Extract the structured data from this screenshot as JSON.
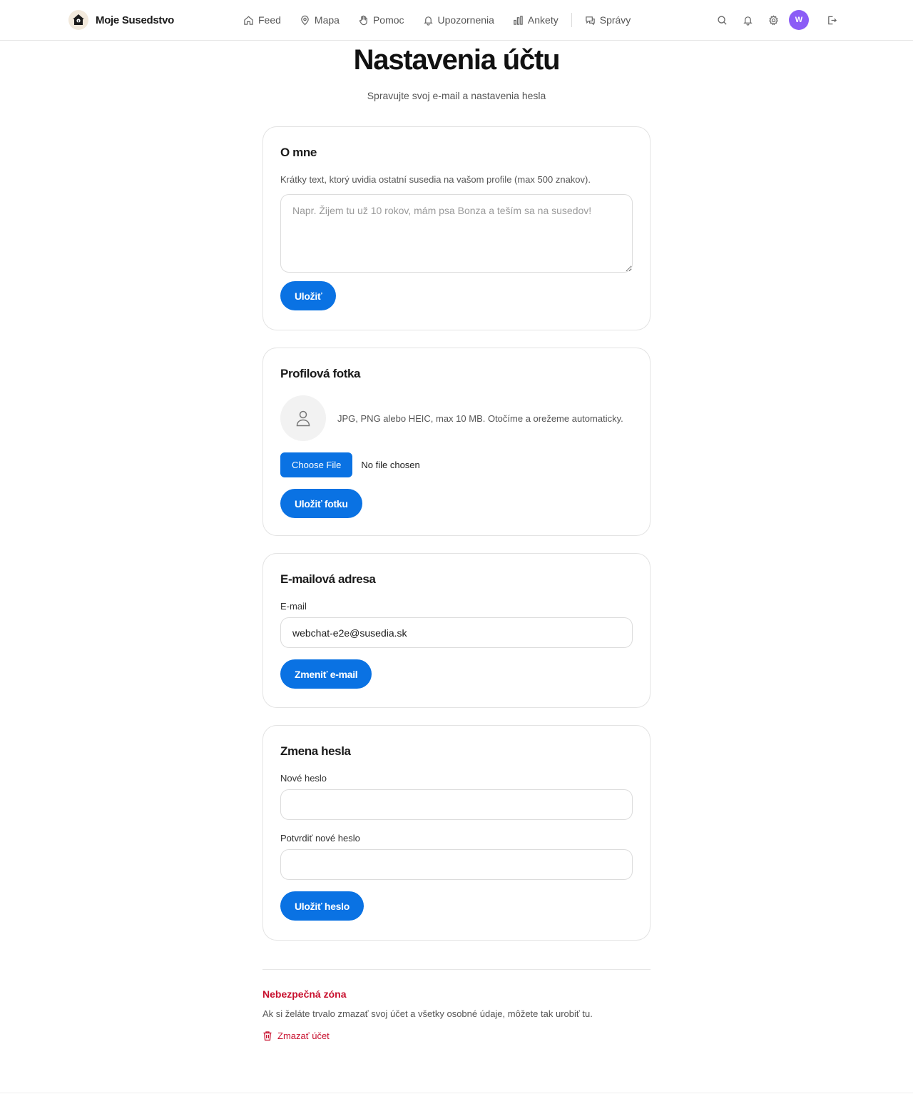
{
  "header": {
    "brand_name": "Moje Susedstvo",
    "nav": [
      {
        "label": "Feed",
        "icon": "home-icon"
      },
      {
        "label": "Mapa",
        "icon": "map-pin-icon"
      },
      {
        "label": "Pomoc",
        "icon": "hand-icon"
      },
      {
        "label": "Upozornenia",
        "icon": "bell-icon"
      },
      {
        "label": "Ankety",
        "icon": "bar-chart-icon"
      },
      {
        "label": "Správy",
        "icon": "chat-icon"
      }
    ],
    "avatar_initial": "W"
  },
  "page": {
    "title": "Nastavenia účtu",
    "subtitle": "Spravujte svoj e-mail a nastavenia hesla"
  },
  "about": {
    "title": "O mne",
    "description": "Krátky text, ktorý uvidia ostatní susedia na vašom profile (max 500 znakov).",
    "placeholder": "Napr. Žijem tu už 10 rokov, mám psa Bonza a teším sa na susedov!",
    "value": "",
    "save_label": "Uložiť"
  },
  "photo": {
    "title": "Profilová fotka",
    "hint": "JPG, PNG alebo HEIC, max 10 MB. Otočíme a orežeme automaticky.",
    "choose_label": "Choose File",
    "file_status": "No file chosen",
    "save_label": "Uložiť fotku"
  },
  "email": {
    "title": "E-mailová adresa",
    "label": "E-mail",
    "value": "webchat-e2e@susedia.sk",
    "save_label": "Zmeniť e-mail"
  },
  "password": {
    "title": "Zmena hesla",
    "new_label": "Nové heslo",
    "confirm_label": "Potvrdiť nové heslo",
    "save_label": "Uložiť heslo"
  },
  "danger": {
    "title": "Nebezpečná zóna",
    "description": "Ak si želáte trvalo zmazať svoj účet a všetky osobné údaje, môžete tak urobiť tu.",
    "delete_label": "Zmazať účet"
  },
  "colors": {
    "accent": "#0a72e3",
    "danger": "#c8102e",
    "avatar": "#8b5cf6"
  }
}
